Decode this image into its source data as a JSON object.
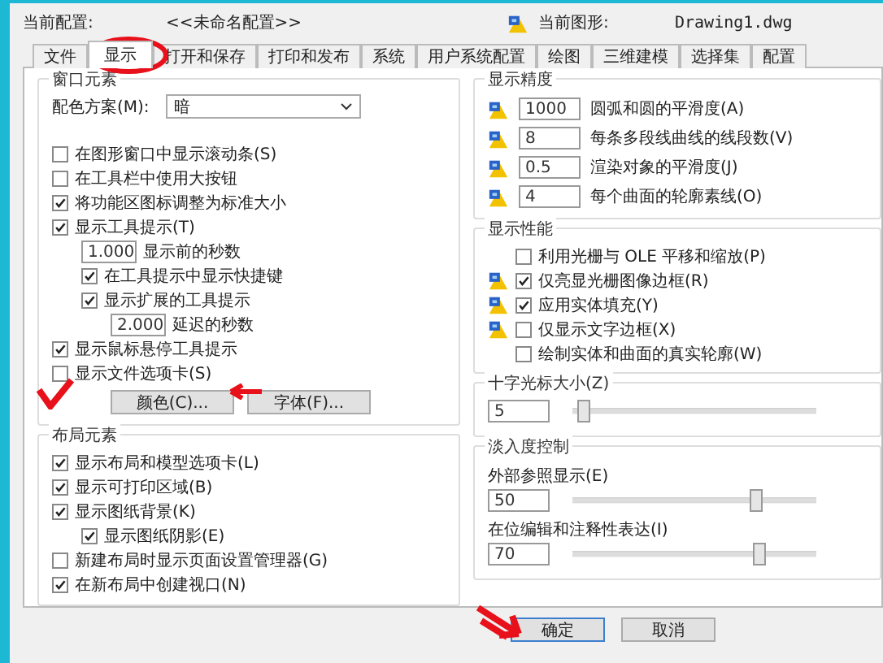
{
  "header": {
    "profile_label": "当前配置:",
    "profile_value": "<<未命名配置>>",
    "drawing_label": "当前图形:",
    "drawing_value": "Drawing1.dwg"
  },
  "tabs": [
    {
      "label": "文件",
      "selected": false
    },
    {
      "label": "显示",
      "selected": true
    },
    {
      "label": "打开和保存",
      "selected": false
    },
    {
      "label": "打印和发布",
      "selected": false
    },
    {
      "label": "系统",
      "selected": false
    },
    {
      "label": "用户系统配置",
      "selected": false
    },
    {
      "label": "绘图",
      "selected": false
    },
    {
      "label": "三维建模",
      "selected": false
    },
    {
      "label": "选择集",
      "selected": false
    },
    {
      "label": "配置",
      "selected": false
    }
  ],
  "window_elements": {
    "title": "窗口元素",
    "color_scheme": {
      "label": "配色方案(M):",
      "value": "暗"
    },
    "options": [
      {
        "kind": "checkbox",
        "label": "在图形窗口中显示滚动条(S)",
        "checked": false
      },
      {
        "kind": "checkbox",
        "label": "在工具栏中使用大按钮",
        "checked": false
      },
      {
        "kind": "checkbox",
        "label": "将功能区图标调整为标准大小",
        "checked": true
      },
      {
        "kind": "checkbox",
        "label": "显示工具提示(T)",
        "checked": true,
        "children": [
          {
            "kind": "number",
            "value": "1.000",
            "label": "显示前的秒数"
          },
          {
            "kind": "checkbox",
            "label": "在工具提示中显示快捷键",
            "checked": true
          },
          {
            "kind": "checkbox",
            "label": "显示扩展的工具提示",
            "checked": true,
            "children": [
              {
                "kind": "number",
                "value": "2.000",
                "label": "延迟的秒数"
              }
            ]
          }
        ]
      },
      {
        "kind": "checkbox",
        "label": "显示鼠标悬停工具提示",
        "checked": true
      },
      {
        "kind": "checkbox",
        "label": "显示文件选项卡(S)",
        "checked": false
      }
    ],
    "buttons": [
      "颜色(C)...",
      "字体(F)..."
    ]
  },
  "layout_elements": {
    "title": "布局元素",
    "options": [
      {
        "kind": "checkbox",
        "label": "显示布局和模型选项卡(L)",
        "checked": true
      },
      {
        "kind": "checkbox",
        "label": "显示可打印区域(B)",
        "checked": true
      },
      {
        "kind": "checkbox",
        "label": "显示图纸背景(K)",
        "checked": true,
        "children": [
          {
            "kind": "checkbox",
            "label": "显示图纸阴影(E)",
            "checked": true
          }
        ]
      },
      {
        "kind": "checkbox",
        "label": "新建布局时显示页面设置管理器(G)",
        "checked": false
      },
      {
        "kind": "checkbox",
        "label": "在新布局中创建视口(N)",
        "checked": true
      }
    ]
  },
  "display_resolution": {
    "title": "显示精度",
    "items": [
      {
        "value": "1000",
        "label": "圆弧和圆的平滑度(A)"
      },
      {
        "value": "8",
        "label": "每条多段线曲线的线段数(V)"
      },
      {
        "value": "0.5",
        "label": "渲染对象的平滑度(J)"
      },
      {
        "value": "4",
        "label": "每个曲面的轮廓素线(O)"
      }
    ]
  },
  "display_performance": {
    "title": "显示性能",
    "items": [
      {
        "label": "利用光栅与 OLE 平移和缩放(P)",
        "checked": false,
        "icon": false
      },
      {
        "label": "仅亮显光栅图像边框(R)",
        "checked": true,
        "icon": true
      },
      {
        "label": "应用实体填充(Y)",
        "checked": true,
        "icon": true
      },
      {
        "label": "仅显示文字边框(X)",
        "checked": false,
        "icon": true
      },
      {
        "label": "绘制实体和曲面的真实轮廓(W)",
        "checked": false,
        "icon": false
      }
    ]
  },
  "crosshair": {
    "title": "十字光标大小(Z)",
    "value": "5",
    "level": 0.05
  },
  "fade_control": {
    "title": "淡入度控制",
    "items": [
      {
        "label": "外部参照显示(E)",
        "value": "50",
        "level": 0.76
      },
      {
        "label": "在位编辑和注释性表达(I)",
        "value": "70",
        "level": 0.77
      }
    ]
  },
  "buttons": [
    "确定",
    "取消"
  ]
}
